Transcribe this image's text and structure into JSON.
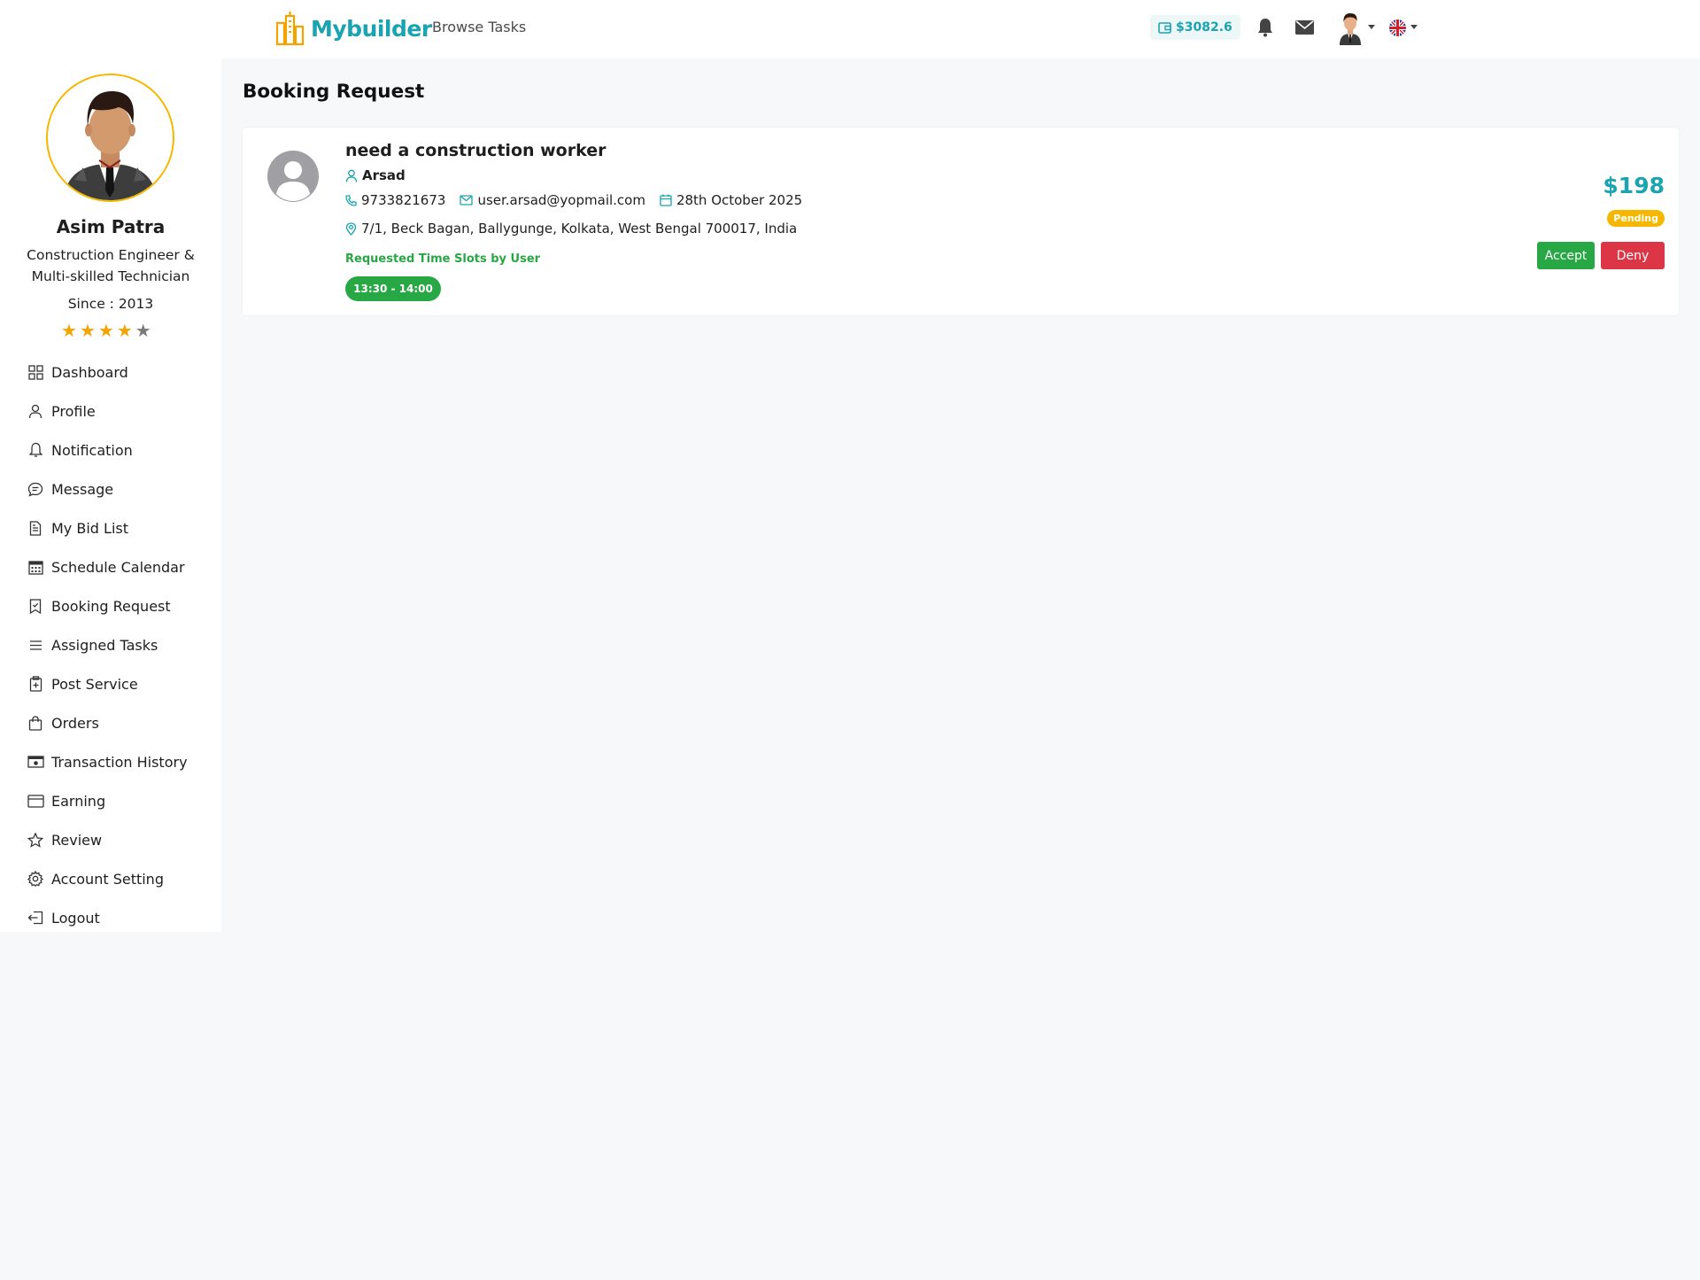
{
  "header": {
    "brand": "Mybuilder",
    "nav_link": "Browse Tasks",
    "wallet_balance": "$3082.6",
    "icons": [
      "wallet-icon",
      "bell-icon",
      "mail-icon",
      "user-avatar",
      "uk-flag-icon"
    ]
  },
  "sidebar": {
    "name": "Asim Patra",
    "title": "Construction Engineer & Multi-skilled Technician",
    "since": "Since : 2013",
    "rating": 4,
    "rating_max": 5,
    "items": [
      {
        "label": "Dashboard",
        "icon": "dashboard-icon"
      },
      {
        "label": "Profile",
        "icon": "user-icon"
      },
      {
        "label": "Notification",
        "icon": "bell-icon"
      },
      {
        "label": "Message",
        "icon": "chat-icon"
      },
      {
        "label": "My Bid List",
        "icon": "document-icon"
      },
      {
        "label": "Schedule Calendar",
        "icon": "calendar-icon"
      },
      {
        "label": "Booking Request",
        "icon": "bookmark-icon"
      },
      {
        "label": "Assigned Tasks",
        "icon": "list-icon"
      },
      {
        "label": "Post Service",
        "icon": "clipboard-plus-icon"
      },
      {
        "label": "Orders",
        "icon": "bag-icon"
      },
      {
        "label": "Transaction History",
        "icon": "cash-icon"
      },
      {
        "label": "Earning",
        "icon": "card-icon"
      },
      {
        "label": "Review",
        "icon": "star-icon"
      },
      {
        "label": "Account Setting",
        "icon": "gear-icon"
      },
      {
        "label": "Logout",
        "icon": "logout-icon"
      }
    ]
  },
  "main": {
    "page_title": "Booking Request",
    "booking": {
      "job_title": "need a construction worker",
      "user_name": "Arsad",
      "phone": "9733821673",
      "email": "user.arsad@yopmail.com",
      "date": "28th October 2025",
      "address": "7/1, Beck Bagan, Ballygunge, Kolkata, West Bengal 700017, India",
      "slots_label": "Requested Time Slots by User",
      "slot": "13:30 - 14:00",
      "price": "$198",
      "status": "Pending",
      "accept_label": "Accept",
      "deny_label": "Deny"
    }
  },
  "colors": {
    "accent": "#1aa3b1",
    "success": "#28a745",
    "danger": "#dc3545",
    "warning": "#f5b700"
  }
}
